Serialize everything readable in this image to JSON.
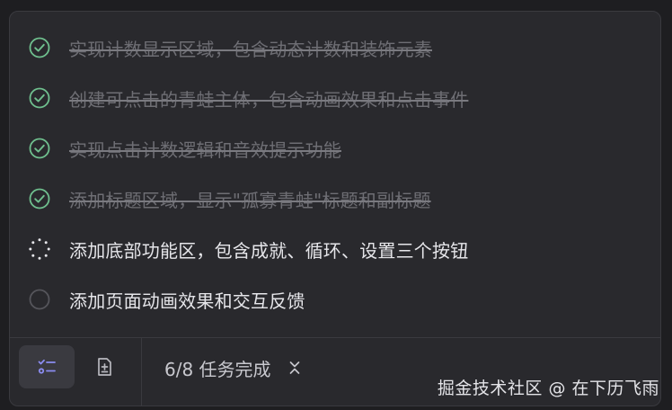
{
  "tasks": [
    {
      "label": "实现计数显示区域，包含动态计数和装饰元素",
      "status": "done"
    },
    {
      "label": "创建可点击的青蛙主体，包含动画效果和点击事件",
      "status": "done"
    },
    {
      "label": "实现点击计数逻辑和音效提示功能",
      "status": "done"
    },
    {
      "label": "添加标题区域，显示\"孤寡青蛙\"标题和副标题",
      "status": "done"
    },
    {
      "label": "添加底部功能区，包含成就、循环、设置三个按钮",
      "status": "in-progress"
    },
    {
      "label": "添加页面动画效果和交互反馈",
      "status": "pending"
    }
  ],
  "footer": {
    "progress_label": "6/8 任务完成"
  },
  "watermark": "掘金技术社区 @ 在下历飞雨",
  "colors": {
    "done_check": "#6fbf8e",
    "pending_ring": "#55555b",
    "spinner": "#e6e6ea",
    "icon_accent": "#8b8cf0"
  },
  "icons": {
    "done": "check-circle-icon",
    "in_progress": "spinner-icon",
    "pending": "empty-circle-icon",
    "task_list": "task-list-icon",
    "add_task": "document-plus-icon",
    "expand": "chevron-up-down-icon"
  }
}
